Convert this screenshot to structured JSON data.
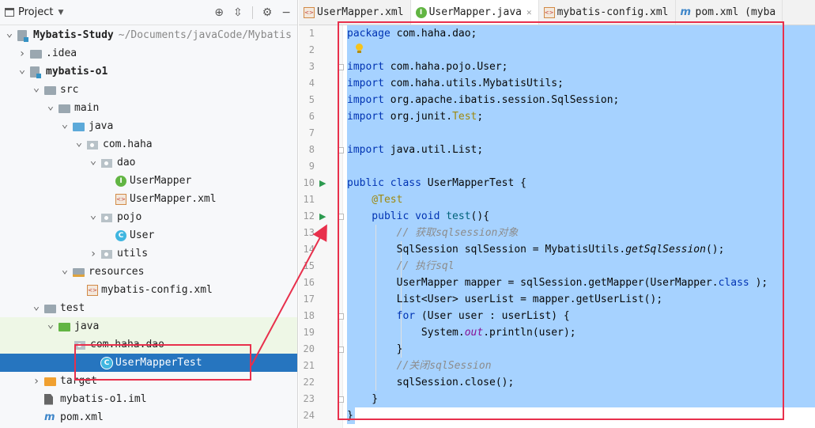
{
  "panel": {
    "title": "Project",
    "tree": [
      {
        "label": "Mybatis-Study",
        "path": "~/Documents/javaCode/Mybatis",
        "bold": true
      },
      {
        "label": ".idea"
      },
      {
        "label": "mybatis-o1",
        "bold": true
      },
      {
        "label": "src"
      },
      {
        "label": "main"
      },
      {
        "label": "java"
      },
      {
        "label": "com.haha"
      },
      {
        "label": "dao"
      },
      {
        "label": "UserMapper"
      },
      {
        "label": "UserMapper.xml"
      },
      {
        "label": "pojo"
      },
      {
        "label": "User"
      },
      {
        "label": "utils"
      },
      {
        "label": "resources"
      },
      {
        "label": "mybatis-config.xml"
      },
      {
        "label": "test"
      },
      {
        "label": "java"
      },
      {
        "label": "com.haha.dao"
      },
      {
        "label": "UserMapperTest"
      },
      {
        "label": "target"
      },
      {
        "label": "mybatis-o1.iml"
      },
      {
        "label": "pom.xml"
      }
    ]
  },
  "tabs": [
    {
      "label": "UserMapper.xml"
    },
    {
      "label": "UserMapper.java"
    },
    {
      "label": "mybatis-config.xml"
    },
    {
      "label": "pom.xml (myba"
    }
  ],
  "editor": {
    "line_numbers": [
      "1",
      "2",
      "3",
      "4",
      "5",
      "6",
      "7",
      "8",
      "9",
      "10",
      "11",
      "12",
      "13",
      "14",
      "15",
      "16",
      "17",
      "18",
      "19",
      "20",
      "21",
      "22",
      "23",
      "24"
    ],
    "lines": [
      [
        [
          "kw",
          "package"
        ],
        [
          "",
          "com.haha.dao;"
        ]
      ],
      [],
      [
        [
          "kw",
          "import"
        ],
        [
          "",
          "com.haha.pojo.User;"
        ]
      ],
      [
        [
          "kw",
          "import"
        ],
        [
          "",
          "com.haha.utils.MybatisUtils;"
        ]
      ],
      [
        [
          "kw",
          "import"
        ],
        [
          "",
          "org.apache.ibatis.session.SqlSession;"
        ]
      ],
      [
        [
          "kw",
          "import"
        ],
        [
          "",
          "org.junit."
        ],
        [
          "ann",
          "Test"
        ],
        [
          "",
          ";"
        ]
      ],
      [],
      [
        [
          "kw",
          "import"
        ],
        [
          "",
          "java.util.List;"
        ]
      ],
      [],
      [
        [
          "kw",
          "public"
        ],
        [
          "kw",
          "class"
        ],
        [
          "",
          " UserMapperTest {"
        ]
      ],
      [
        [
          "ann",
          "    @Test"
        ]
      ],
      [
        [
          "kw",
          "    public"
        ],
        [
          "kw",
          "void"
        ],
        [
          "fn",
          "test"
        ],
        [
          "",
          "(){"
        ]
      ],
      [
        [
          "cmt",
          "        // 获取sqlsession对象"
        ]
      ],
      [
        [
          "",
          "        SqlSession sqlSession = MybatisUtils."
        ],
        [
          "it",
          "getSqlSession"
        ],
        [
          "",
          "();"
        ]
      ],
      [
        [
          "cmt",
          "        // 执行sql"
        ]
      ],
      [
        [
          "",
          "        UserMapper mapper = sqlSession.getMapper(UserMapper."
        ],
        [
          "kw",
          "class"
        ],
        [
          "",
          ");"
        ]
      ],
      [
        [
          "",
          "        List<User> userList = mapper.getUserList();"
        ]
      ],
      [
        [
          "kw",
          "        for"
        ],
        [
          "",
          " (User user : userList) {"
        ]
      ],
      [
        [
          "",
          "            System."
        ],
        [
          "fld",
          "out"
        ],
        [
          "",
          ".println(user);"
        ]
      ],
      [
        [
          "",
          "        }"
        ]
      ],
      [
        [
          "cmt",
          "        //关闭sqlSession"
        ]
      ],
      [
        [
          "",
          "        sqlSession.close();"
        ]
      ],
      [
        [
          "",
          "    }"
        ]
      ],
      [
        [
          "",
          "}"
        ]
      ]
    ]
  },
  "colors": {
    "selection": "#a6d2ff",
    "selected_row": "#2675bf",
    "annotation_red": "#e8304c",
    "keyword": "#0033b3"
  }
}
